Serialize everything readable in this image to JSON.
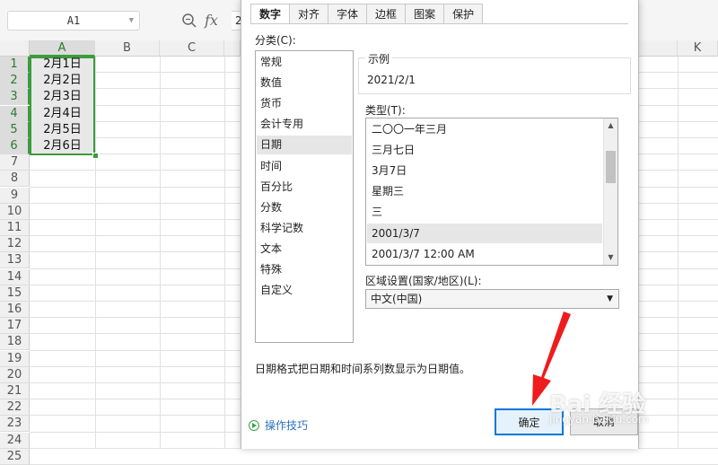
{
  "formula_bar": {
    "cell_ref": "A1",
    "fx_label": "fx",
    "value_preview": "2"
  },
  "sheet": {
    "columns_left": [
      "A",
      "B",
      "C"
    ],
    "column_right": "K",
    "rows": [
      "1",
      "2",
      "3",
      "4",
      "5",
      "6",
      "7",
      "8",
      "9",
      "10",
      "11",
      "12",
      "13",
      "14",
      "15",
      "16",
      "17",
      "18",
      "19",
      "20",
      "21",
      "22",
      "23",
      "24",
      "25"
    ],
    "cells_A": [
      "2月1日",
      "2月2日",
      "2月3日",
      "2月4日",
      "2月5日",
      "2月6日"
    ]
  },
  "dialog": {
    "tabs": [
      "数字",
      "对齐",
      "字体",
      "边框",
      "图案",
      "保护"
    ],
    "category_label": "分类(C):",
    "categories": [
      "常规",
      "数值",
      "货币",
      "会计专用",
      "日期",
      "时间",
      "百分比",
      "分数",
      "科学记数",
      "文本",
      "特殊",
      "自定义"
    ],
    "selected_category": "日期",
    "sample_label": "示例",
    "sample_value": "2021/2/1",
    "type_label": "类型(T):",
    "types": [
      "二〇〇一年三月",
      "三月七日",
      "3月7日",
      "星期三",
      "三",
      "2001/3/7",
      "2001/3/7 12:00 AM"
    ],
    "selected_type": "2001/3/7",
    "locale_label": "区域设置(国家/地区)(L):",
    "locale_value": "中文(中国)",
    "description": "日期格式把日期和时间系列数显示为日期值。",
    "tips_link": "操作技巧",
    "ok_label": "确定",
    "cancel_label": "取消"
  },
  "watermark": {
    "text": "Bai 经验",
    "sub": "jingyan.baidu.com"
  },
  "colors": {
    "selection_green": "#3c9b3c",
    "annotation_red": "#ee1c1c",
    "ok_border": "#0078d7"
  }
}
